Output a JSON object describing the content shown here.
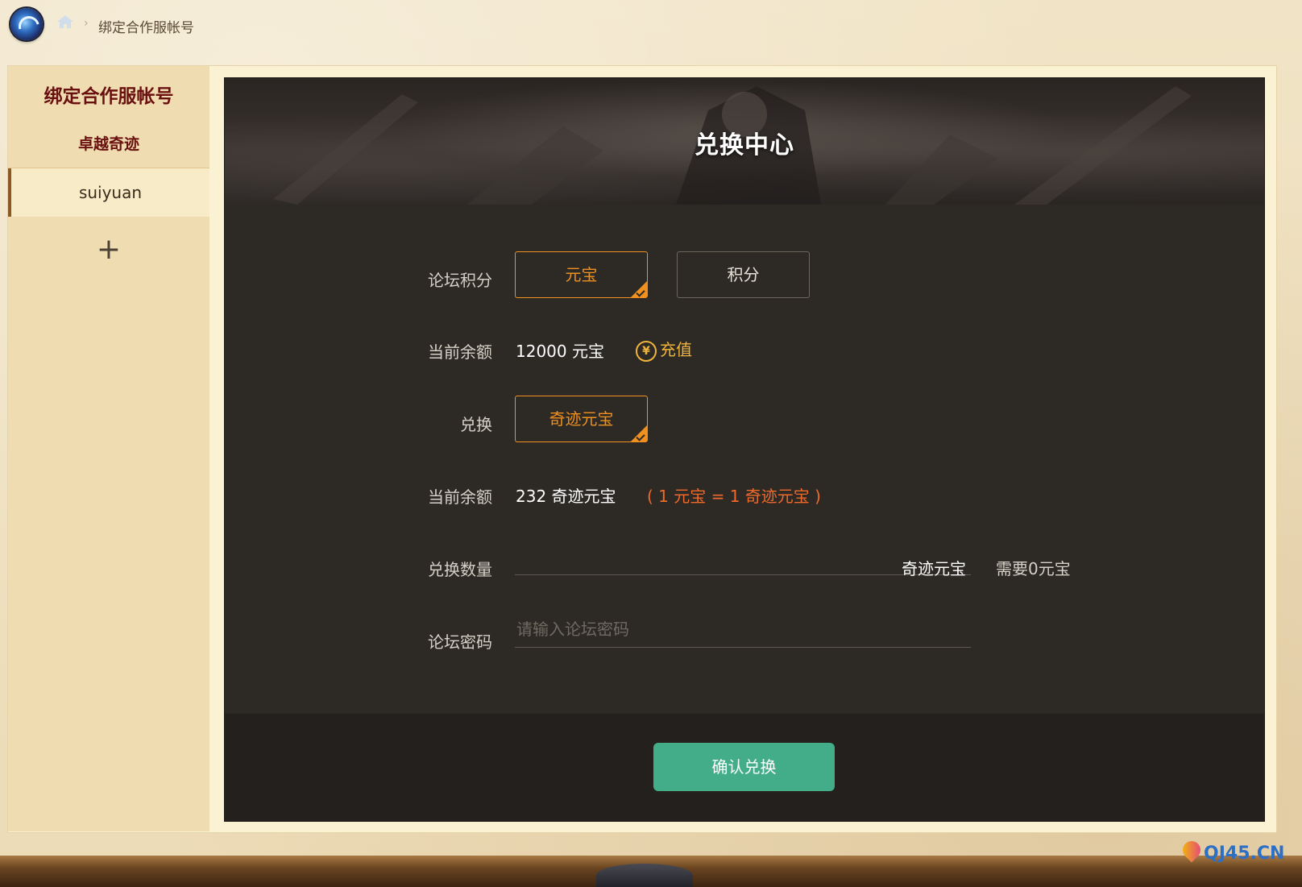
{
  "breadcrumb": {
    "current": "绑定合作服帐号",
    "separator": "›"
  },
  "sidebar": {
    "title": "绑定合作服帐号",
    "game": "卓越奇迹",
    "account": "suiyuan",
    "add_label": "+"
  },
  "banner": {
    "title": "兑换中心"
  },
  "form": {
    "forum_points_label": "论坛积分",
    "currency_options": [
      {
        "label": "元宝",
        "selected": true
      },
      {
        "label": "积分",
        "selected": false
      }
    ],
    "balance_label": "当前余额",
    "balance_value": "12000 元宝",
    "recharge_label": "充值",
    "recharge_icon": "¥",
    "exchange_label": "兑换",
    "exchange_option": {
      "label": "奇迹元宝",
      "selected": true
    },
    "target_balance_label": "当前余额",
    "target_balance_value": "232 奇迹元宝",
    "rate_text": "( 1 元宝 = 1 奇迹元宝 )",
    "quantity_label": "兑换数量",
    "quantity_value": "",
    "quantity_unit": "奇迹元宝",
    "need_text": "需要0元宝",
    "password_label": "论坛密码",
    "password_placeholder": "请输入论坛密码",
    "confirm_label": "确认兑换"
  },
  "watermark": {
    "text": "QJ45.CN"
  },
  "colors": {
    "accent_orange": "#f0901e",
    "rate_orange": "#ef6a2a",
    "recharge_gold": "#f0b43a",
    "confirm_green": "#43ad8a",
    "sidebar_title": "#6a1010",
    "panel_bg": "#2d2a26"
  }
}
